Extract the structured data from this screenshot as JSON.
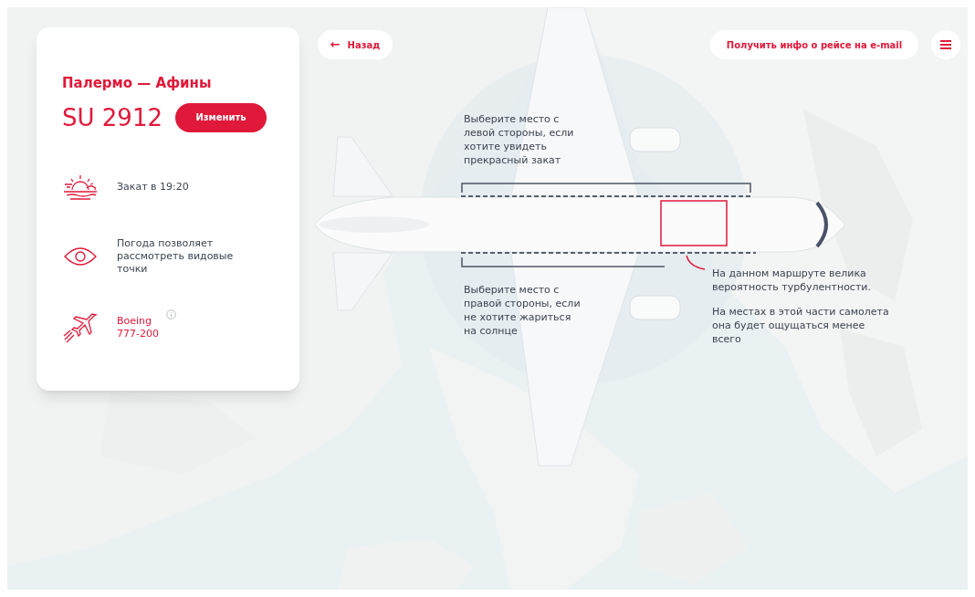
{
  "nav": {
    "back_button": {
      "arrow": "←",
      "label": "Назад"
    },
    "email_button": {
      "label": "Получить инфо о рейсе на e-mail"
    }
  },
  "flight_card": {
    "route": "Палермо — Афины",
    "flight_number": "SU 2912",
    "change_button": "Изменить",
    "features": [
      {
        "kind": "sunset",
        "text": "Закат в 19:20"
      },
      {
        "kind": "view",
        "text": "Погода позволяет рассмотреть видовые точки"
      },
      {
        "kind": "aircraft",
        "text": "Boeing 777-200"
      }
    ]
  },
  "seat_map": {
    "left_side_hint": "Выберите место с левой стороны, если хотите увидеть прекрасный закат",
    "right_side_hint": "Выберите место с правой стороны, если не хотите жариться на солнце",
    "turbulence_notes": [
      "На данном маршруте велика вероятность турбулентности.",
      "На местах в этой части самолета она будет ощущаться менее всего"
    ]
  }
}
